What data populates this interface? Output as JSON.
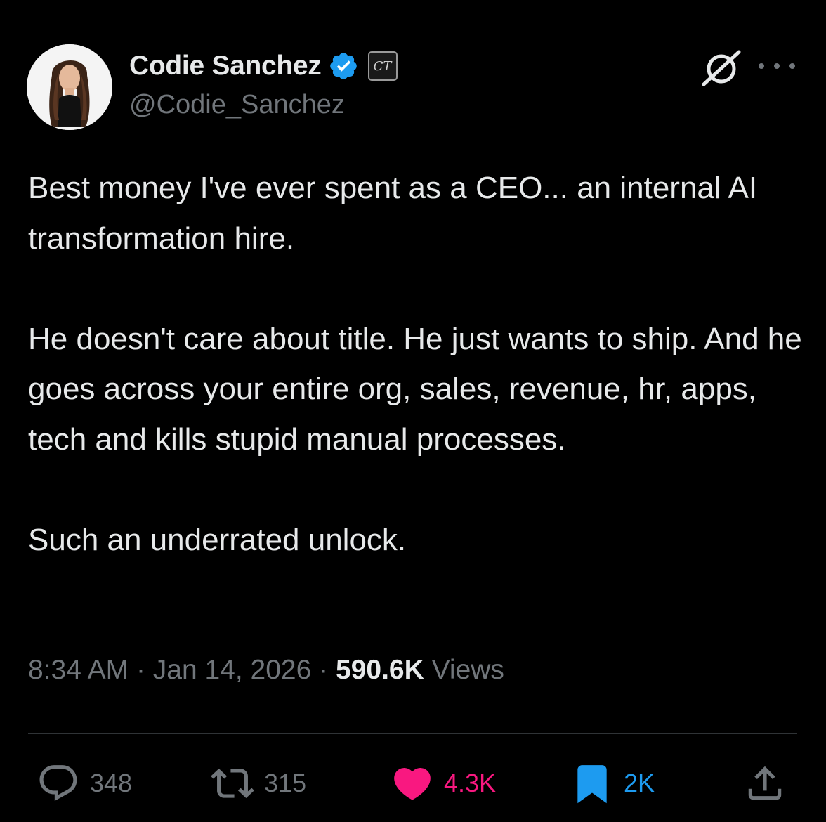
{
  "author": {
    "display_name": "Codie Sanchez",
    "handle": "@Codie_Sanchez",
    "affiliate_badge": "CT",
    "verified_color": "#1d9bf0"
  },
  "tweet": {
    "paragraphs": [
      "Best money I've ever spent as a CEO... an internal AI transformation hire.",
      "He doesn't care about title. He just wants to ship. And he goes across your entire org, sales, revenue, hr, apps, tech and kills stupid manual processes.",
      "Such an underrated unlock."
    ],
    "time": "8:34 AM",
    "separator": "·",
    "date": "Jan 14, 2026",
    "views_count": "590.6K",
    "views_label": "Views"
  },
  "actions": {
    "replies": "348",
    "retweets": "315",
    "likes": "4.3K",
    "bookmarks": "2K"
  },
  "colors": {
    "background": "#000000",
    "text": "#e7e9ea",
    "muted": "#71767b",
    "like": "#f91880",
    "bookmark": "#1d9bf0",
    "divider": "#2f3336"
  },
  "icons": {
    "header_right": [
      "grok-icon",
      "more-icon"
    ],
    "actions": [
      "reply-icon",
      "retweet-icon",
      "like-icon",
      "bookmark-icon",
      "share-icon"
    ]
  }
}
